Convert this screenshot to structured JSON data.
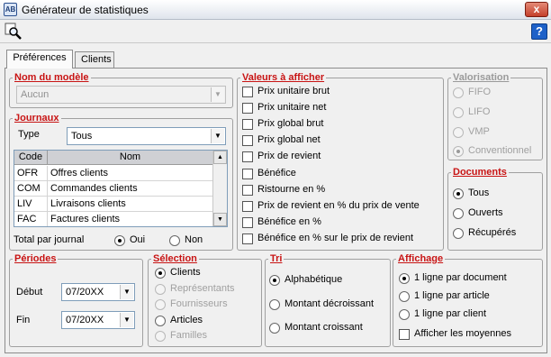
{
  "window": {
    "title": "Générateur de statistiques",
    "close_label": "x",
    "icon_text": "AB"
  },
  "toolbar": {
    "help_label": "?"
  },
  "tabs": [
    {
      "label": "Préférences"
    },
    {
      "label": "Clients"
    }
  ],
  "modele": {
    "legend": "Nom du modèle",
    "value": "Aucun"
  },
  "journaux": {
    "legend": "Journaux",
    "type_label": "Type",
    "type_value": "Tous",
    "columns": [
      "Code",
      "Nom"
    ],
    "rows": [
      {
        "code": "OFR",
        "nom": "Offres clients"
      },
      {
        "code": "COM",
        "nom": "Commandes clients"
      },
      {
        "code": "LIV",
        "nom": "Livraisons clients"
      },
      {
        "code": "FAC",
        "nom": "Factures clients"
      }
    ],
    "total_label": "Total par journal",
    "oui": "Oui",
    "non": "Non"
  },
  "valeurs": {
    "legend": "Valeurs à afficher",
    "items": [
      "Prix unitaire brut",
      "Prix unitaire net",
      "Prix global brut",
      "Prix global net",
      "Prix de revient",
      "Bénéfice",
      "Ristourne en %",
      "Prix de revient en % du prix de vente",
      "Bénéfice en %",
      "Bénéfice en % sur le prix de revient"
    ]
  },
  "valorisation": {
    "legend": "Valorisation",
    "items": [
      "FIFO",
      "LIFO",
      "VMP",
      "Conventionnel"
    ],
    "selected": 3
  },
  "documents": {
    "legend": "Documents",
    "items": [
      "Tous",
      "Ouverts",
      "Récupérés"
    ],
    "selected": 0
  },
  "periodes": {
    "legend": "Périodes",
    "debut_label": "Début",
    "debut_value": "07/20XX",
    "fin_label": "Fin",
    "fin_value": "07/20XX"
  },
  "selection": {
    "legend": "Sélection",
    "items": [
      "Clients",
      "Représentants",
      "Fournisseurs",
      "Articles",
      "Familles"
    ],
    "selected": 0
  },
  "tri": {
    "legend": "Tri",
    "items": [
      "Alphabétique",
      "Montant décroissant",
      "Montant croissant"
    ],
    "selected": 0
  },
  "affichage": {
    "legend": "Affichage",
    "items": [
      "1 ligne par document",
      "1 ligne par article",
      "1 ligne par client"
    ],
    "selected": 0,
    "moyennes_label": "Afficher les moyennes"
  }
}
